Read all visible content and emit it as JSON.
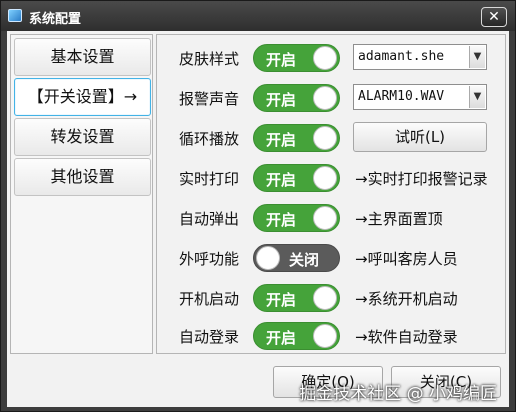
{
  "window": {
    "title": "系统配置",
    "close_symbol": "✕"
  },
  "nav": {
    "items": [
      {
        "label": "基本设置"
      },
      {
        "label": "【开关设置】→"
      },
      {
        "label": "转发设置"
      },
      {
        "label": "其他设置"
      }
    ],
    "selected_index": 1
  },
  "settings": {
    "skin": {
      "label": "皮肤样式",
      "toggle": "开启",
      "on": true,
      "select_value": "adamant.she"
    },
    "alarm_sound": {
      "label": "报警声音",
      "toggle": "开启",
      "on": true,
      "select_value": "ALARM10.WAV"
    },
    "loop_play": {
      "label": "循环播放",
      "toggle": "开启",
      "on": true,
      "button": "试听(L)"
    },
    "realtime_print": {
      "label": "实时打印",
      "toggle": "开启",
      "on": true,
      "note": "→实时打印报警记录"
    },
    "auto_popup": {
      "label": "自动弹出",
      "toggle": "开启",
      "on": true,
      "note": "→主界面置顶"
    },
    "outbound_call": {
      "label": "外呼功能",
      "toggle": "关闭",
      "on": false,
      "note": "→呼叫客房人员"
    },
    "boot_start": {
      "label": "开机启动",
      "toggle": "开启",
      "on": true,
      "note": "→系统开机启动"
    },
    "auto_login": {
      "label": "自动登录",
      "toggle": "开启",
      "on": true,
      "note": "→软件自动登录"
    }
  },
  "footer": {
    "ok": "确定(O)",
    "close": "关闭(C)"
  },
  "watermark": "掘金技术社区 @ 小鸡编匠",
  "colors": {
    "toggle_on": "#45a33a",
    "toggle_off": "#5b5b5b",
    "nav_active_border": "#43b3e6",
    "titlebar": "#3d3d3d"
  }
}
